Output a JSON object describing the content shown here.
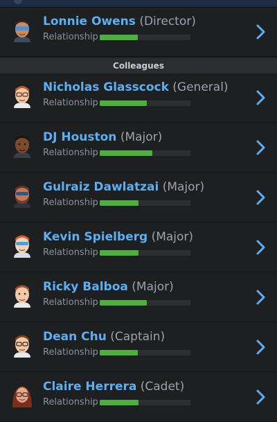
{
  "section_title": "Colleagues",
  "relationship_label": "Relationship",
  "colors": {
    "name": "#5ab0f3",
    "bar_fill": "#4caf3e",
    "bar_track": "#2c2e31",
    "chevron": "#5ab0f3"
  },
  "supervisor": {
    "name": "Lonnie Owens",
    "role": "(Director)",
    "relationship": 0.42,
    "avatar_icon": "man-avatar-sunglasses-icon"
  },
  "colleagues": [
    {
      "name": "Nicholas Glasscock",
      "role": "(General)",
      "relationship": 0.52,
      "avatar_icon": "man-avatar-glasses-icon"
    },
    {
      "name": "DJ Houston",
      "role": "(Major)",
      "relationship": 0.58,
      "avatar_icon": "man-avatar-dark-skin-icon"
    },
    {
      "name": "Gulraiz Dawlatzai",
      "role": "(Major)",
      "relationship": 0.43,
      "avatar_icon": "man-avatar-beard-sunglasses-icon"
    },
    {
      "name": "Kevin Spielberg",
      "role": "(Major)",
      "relationship": 0.43,
      "avatar_icon": "man-avatar-sunglasses-icon"
    },
    {
      "name": "Ricky Balboa",
      "role": "(Major)",
      "relationship": 0.52,
      "avatar_icon": "man-avatar-icon"
    },
    {
      "name": "Dean Chu",
      "role": "(Captain)",
      "relationship": 0.42,
      "avatar_icon": "man-avatar-glasses-icon"
    },
    {
      "name": "Claire Herrera",
      "role": "(Cadet)",
      "relationship": 0.43,
      "avatar_icon": "woman-avatar-glasses-icon"
    }
  ]
}
